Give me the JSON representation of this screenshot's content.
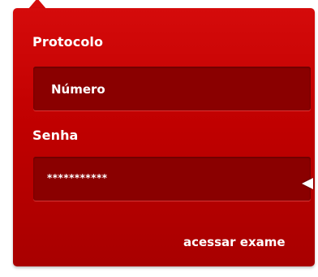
{
  "form": {
    "protocolo_label": "Protocolo",
    "numero_placeholder": "Número",
    "senha_label": "Senha",
    "senha_value": "***********",
    "submit_label": "acessar exame"
  },
  "colors": {
    "panel": "#c00000",
    "field": "#8a0000",
    "text": "#ffffff"
  }
}
